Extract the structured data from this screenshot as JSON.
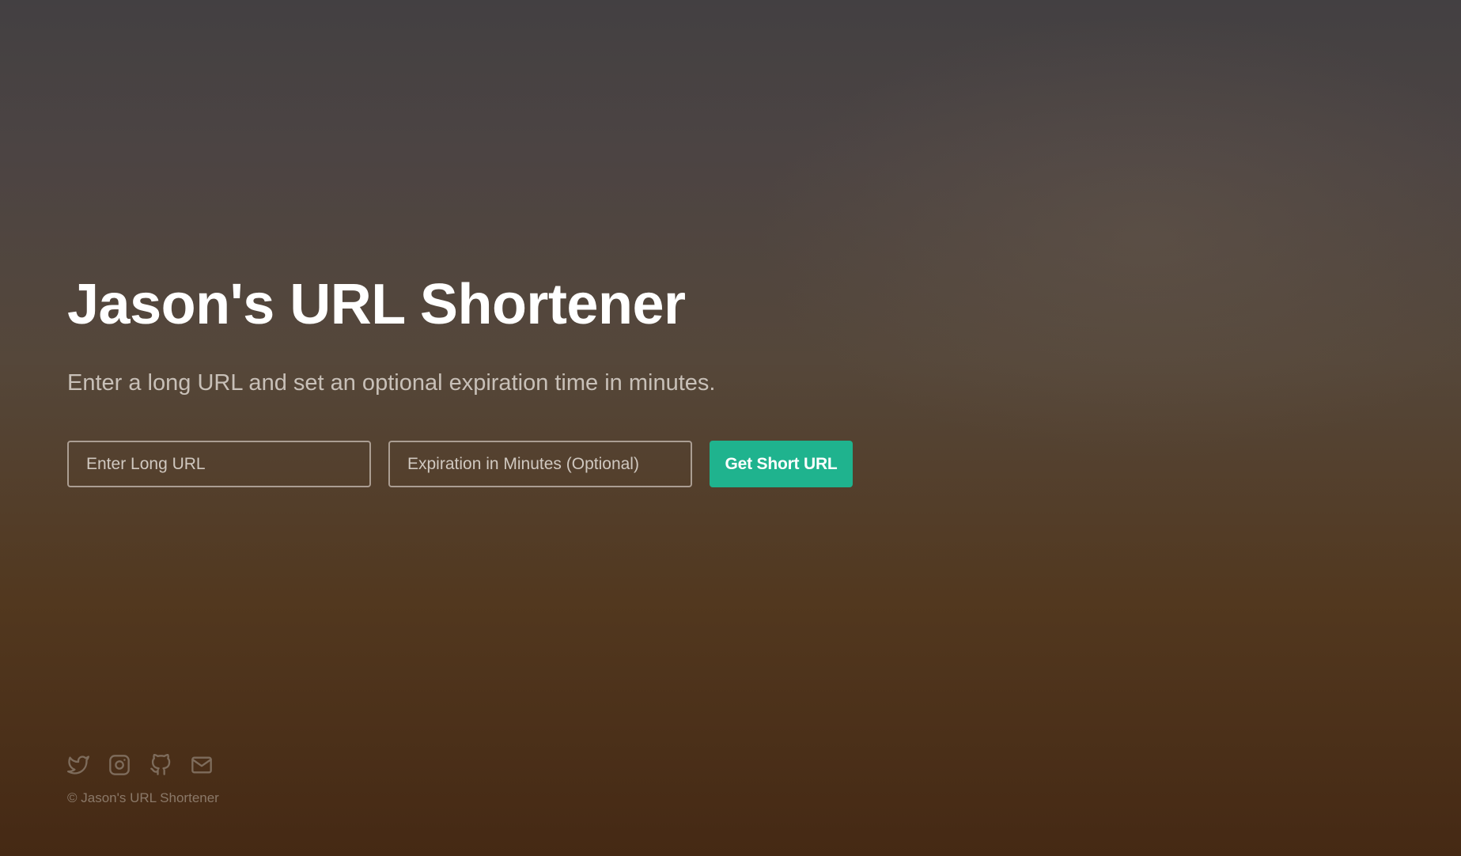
{
  "hero": {
    "title": "Jason's URL Shortener",
    "subtitle": "Enter a long URL and set an optional expiration time in minutes."
  },
  "form": {
    "url_placeholder": "Enter Long URL",
    "url_value": "",
    "expiration_placeholder": "Expiration in Minutes (Optional)",
    "expiration_value": "",
    "submit_label": "Get Short URL"
  },
  "footer": {
    "social_icons": [
      "twitter-icon",
      "instagram-icon",
      "github-icon",
      "mail-icon"
    ],
    "copyright": "© Jason's URL Shortener"
  },
  "colors": {
    "accent": "#1fb38e",
    "title_text": "#ffffff",
    "subtitle_text": "#c8c0b8",
    "footer_icon": "#7e6c5c"
  }
}
